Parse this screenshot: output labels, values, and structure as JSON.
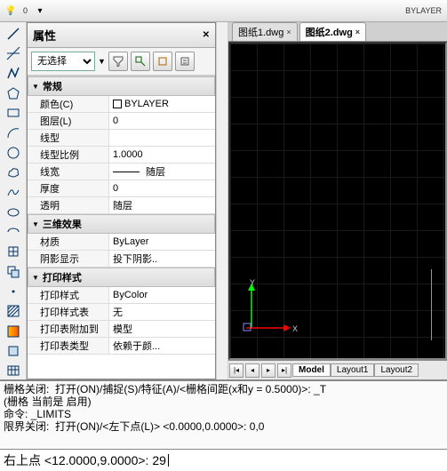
{
  "topbar": {
    "layer_val": "0",
    "bylayer": "BYLAYER"
  },
  "panel": {
    "title": "属性",
    "selector": "无选择",
    "sections": {
      "general": "常规",
      "threeD": "三维效果",
      "plot": "打印样式"
    },
    "rows": {
      "color_l": "颜色(C)",
      "color_v": "BYLAYER",
      "layer_l": "图层(L)",
      "layer_v": "0",
      "ltype_l": "线型",
      "ltype_v": "",
      "ltscale_l": "线型比例",
      "ltscale_v": "1.0000",
      "lweight_l": "线宽",
      "lweight_v": "随层",
      "thick_l": "厚度",
      "thick_v": "0",
      "transp_l": "透明",
      "transp_v": "随层",
      "mat_l": "材质",
      "mat_v": "ByLayer",
      "shadow_l": "阴影显示",
      "shadow_v": "投下阴影..",
      "pstyle_l": "打印样式",
      "pstyle_v": "ByColor",
      "ptable_l": "打印样式表",
      "ptable_v": "无",
      "pattach_l": "打印表附加到",
      "pattach_v": "模型",
      "ptype_l": "打印表类型",
      "ptype_v": "依赖于颜..."
    }
  },
  "docTabs": {
    "t1": "图纸1.dwg",
    "t2": "图纸2.dwg"
  },
  "axes": {
    "x": "X",
    "y": "Y"
  },
  "layoutTabs": {
    "model": "Model",
    "l1": "Layout1",
    "l2": "Layout2"
  },
  "cmd": {
    "l1": "栅格关闭:  打开(ON)/捕捉(S)/特征(A)/<栅格间距(x和y = 0.5000)>: _T",
    "l2": "(栅格 当前是 启用)",
    "l3": "命令: _LIMITS",
    "l4": "限界关闭:  打开(ON)/<左下点(L)> <0.0000,0.0000>: 0,0",
    "input": "右上点 <12.0000,9.0000>: 29"
  }
}
